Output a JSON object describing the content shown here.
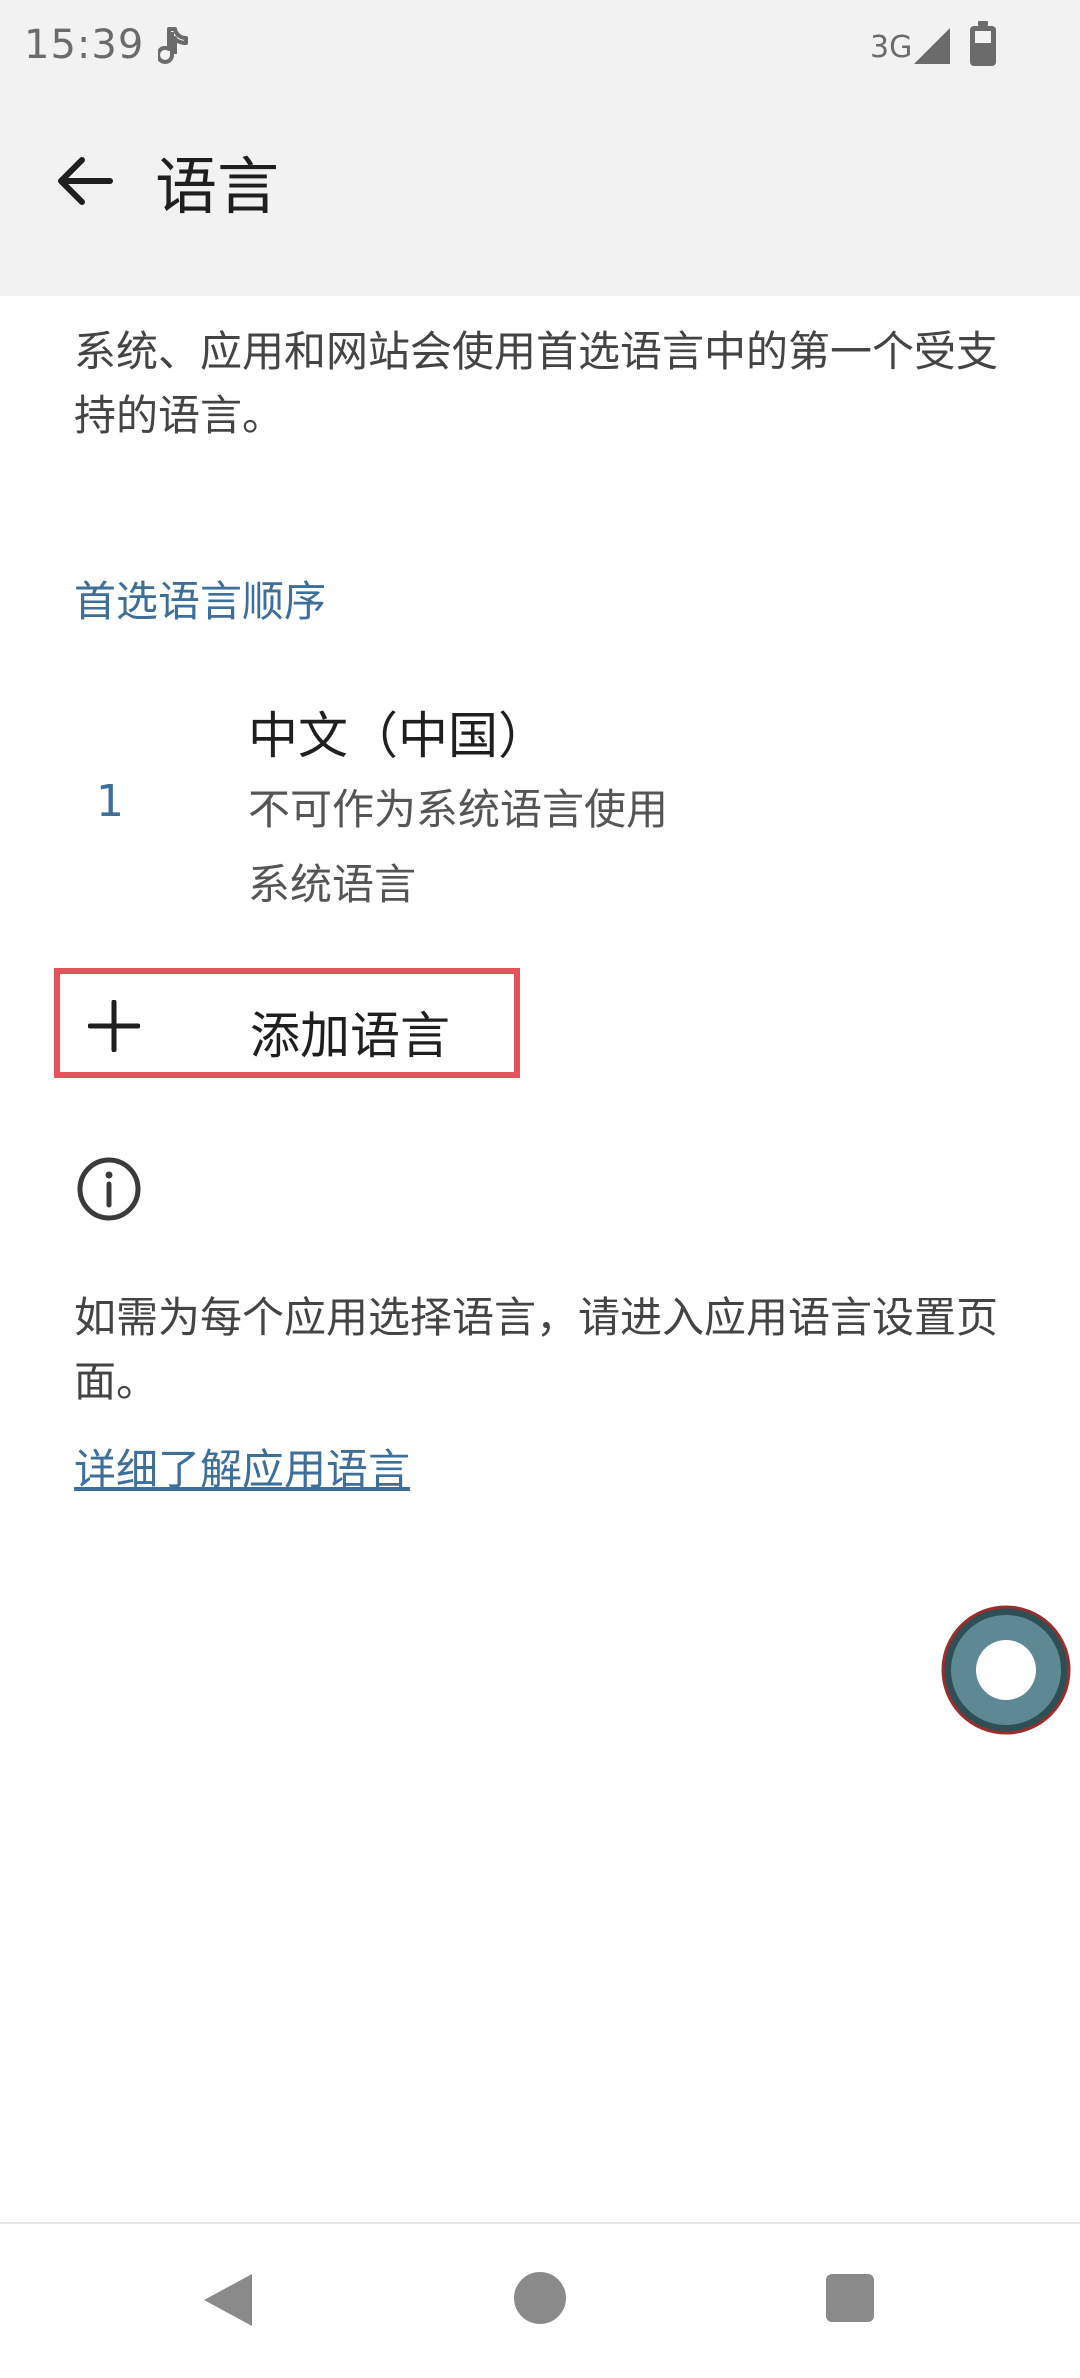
{
  "status_bar": {
    "time": "15:39",
    "network": "3G"
  },
  "header": {
    "title": "语言"
  },
  "main": {
    "description": "系统、应用和网站会使用首选语言中的第一个受支持的语言。",
    "section_header": "首选语言顺序",
    "languages": [
      {
        "number": "1",
        "name": "中文（中国）",
        "note": "不可作为系统语言使用",
        "status": "系统语言"
      }
    ],
    "add_language_label": "添加语言",
    "app_language_info": "如需为每个应用选择语言，请进入应用语言设置页面。",
    "learn_more_link": "详细了解应用语言"
  },
  "colors": {
    "accent": "#3d6f9a",
    "highlight_border": "#e5535a",
    "assist_fill": "#5d8894",
    "assist_ring": "#2f4f57",
    "assist_outline": "#9b2d2d"
  },
  "icons": {
    "back": "arrow-left-icon",
    "plus": "plus-icon",
    "info": "info-icon",
    "nav_back": "triangle-back-icon",
    "nav_home": "circle-home-icon",
    "nav_recents": "square-recents-icon"
  }
}
